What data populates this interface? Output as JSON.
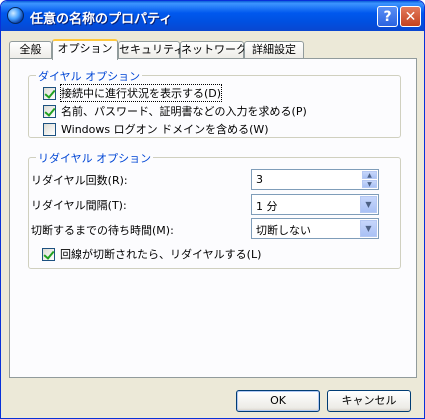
{
  "window": {
    "title": "任意の名称のプロパティ",
    "help_glyph": "?",
    "close_glyph": "✕"
  },
  "tabs": [
    {
      "label": "全般",
      "active": false
    },
    {
      "label": "オプション",
      "active": true
    },
    {
      "label": "セキュリティ",
      "active": false
    },
    {
      "label": "ネットワーク",
      "active": false
    },
    {
      "label": "詳細設定",
      "active": false
    }
  ],
  "dial_options": {
    "title": "ダイヤル オプション",
    "checkboxes": [
      {
        "label": "接続中に進行状況を表示する(D)",
        "checked": true
      },
      {
        "label": "名前、パスワード、証明書などの入力を求める(P)",
        "checked": true
      },
      {
        "label": "Windows ログオン ドメインを含める(W)",
        "checked": false
      }
    ]
  },
  "redial_options": {
    "title": "リダイヤル オプション",
    "redial_count_label": "リダイヤル回数(R):",
    "redial_count_value": "3",
    "redial_interval_label": "リダイヤル間隔(T):",
    "redial_interval_value": "1 分",
    "idle_time_label": "切断するまでの待ち時間(M):",
    "idle_time_value": "切断しない",
    "redial_on_disconnect_label": "回線が切断されたら、リダイヤルする(L)",
    "redial_on_disconnect_checked": true
  },
  "buttons": {
    "ok": "OK",
    "cancel": "キャンセル"
  },
  "colors": {
    "titlebar": "#0058ee",
    "group_title": "#0046d5",
    "dialog_bg": "#ece9d8"
  }
}
